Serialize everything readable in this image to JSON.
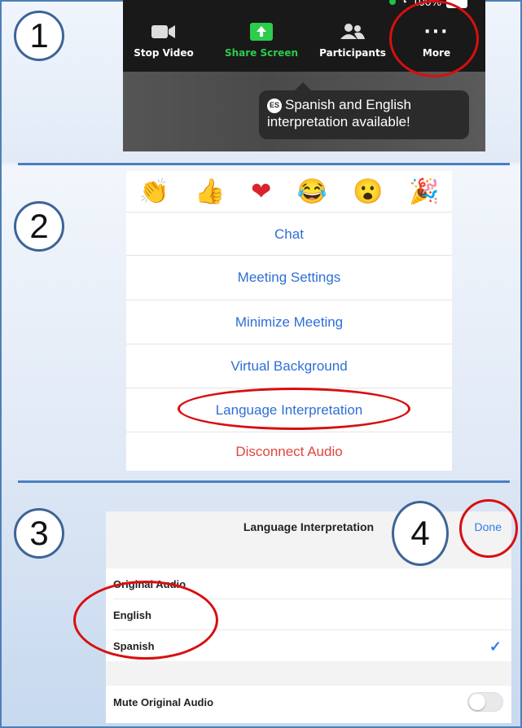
{
  "colors": {
    "accent_blue": "#2e6fd6",
    "danger_red": "#e0453e",
    "highlight_oval": "#d80f0f",
    "zoom_green": "#2ccc4d"
  },
  "steps": [
    "1",
    "2",
    "3",
    "4"
  ],
  "panel1": {
    "status": {
      "battery_text": "100%"
    },
    "toolbar": [
      {
        "label": "Stop Video",
        "icon": "video-camera-icon"
      },
      {
        "label": "Share Screen",
        "icon": "share-screen-icon"
      },
      {
        "label": "Participants",
        "icon": "participants-icon"
      },
      {
        "label": "More",
        "icon": "more-dots-icon"
      }
    ],
    "toast": {
      "badge": "ES",
      "line1": "Spanish and English",
      "line2": "interpretation available!"
    }
  },
  "panel2": {
    "reactions": [
      "clap-emoji",
      "thumbs-up-emoji",
      "heart-emoji",
      "tears-of-joy-emoji",
      "surprised-emoji",
      "party-emoji"
    ],
    "menu_items": [
      "Chat",
      "Meeting Settings",
      "Minimize Meeting",
      "Virtual Background",
      "Language Interpretation",
      "Disconnect Audio"
    ]
  },
  "panel3": {
    "title": "Language Interpretation",
    "done_label": "Done",
    "options": [
      "Original Audio",
      "English",
      "Spanish"
    ],
    "selected": "Spanish",
    "mute_label": "Mute Original Audio",
    "mute_on": false
  }
}
